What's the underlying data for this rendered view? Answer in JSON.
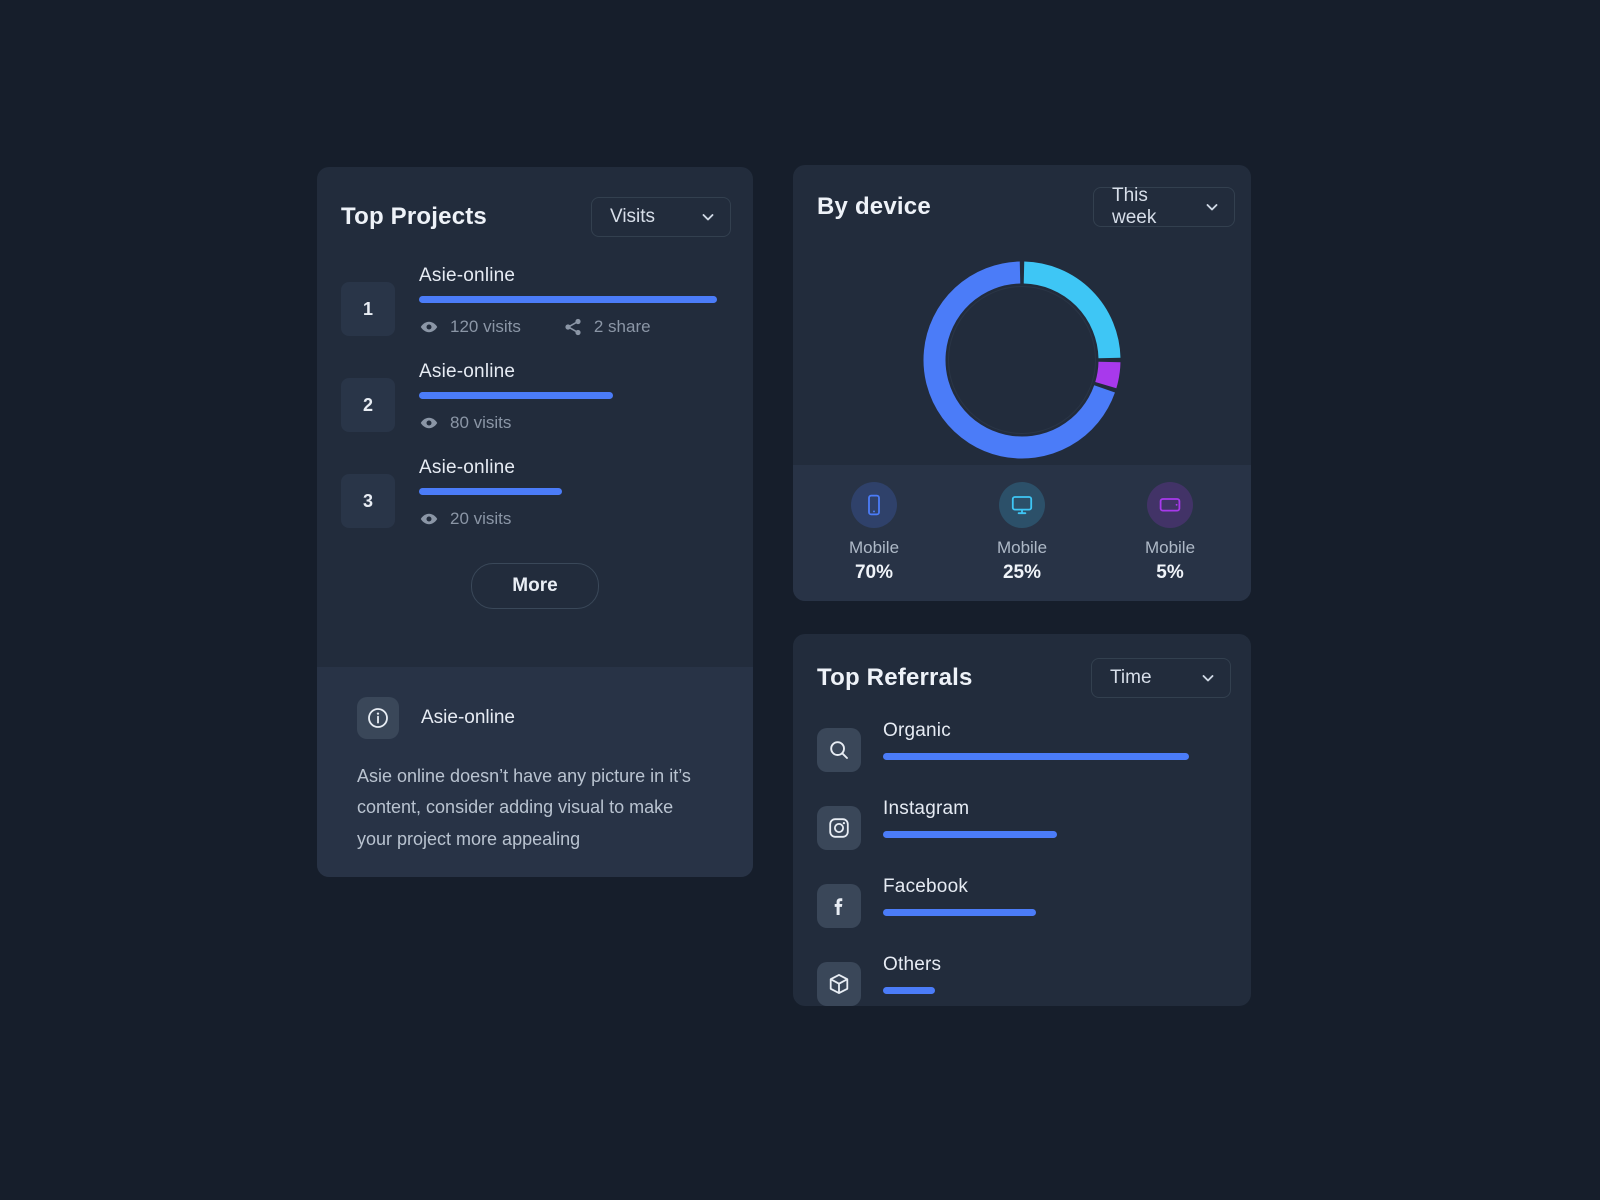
{
  "theme": {
    "page_bg": "#161e2b",
    "card_bg": "#222c3c",
    "panel_bg": "#283346",
    "accent_blue": "#4b7cf8",
    "accent_cyan": "#3ec6f5",
    "accent_purple": "#a839ec",
    "text_primary": "#e6ebf3",
    "text_muted": "#8b96a6"
  },
  "top_projects": {
    "title": "Top Projects",
    "filter": {
      "value": "Visits",
      "icon": "chevron-down-icon"
    },
    "items": [
      {
        "rank": "1",
        "name": "Asie-online",
        "bar_percent": 100,
        "visits_label": "120 visits",
        "visits_icon": "eye-icon",
        "shares_label": "2 share",
        "shares_icon": "share-icon"
      },
      {
        "rank": "2",
        "name": "Asie-online",
        "bar_percent": 65,
        "visits_label": "80 visits",
        "visits_icon": "eye-icon",
        "shares_label": "",
        "shares_icon": ""
      },
      {
        "rank": "3",
        "name": "Asie-online",
        "bar_percent": 48,
        "visits_label": "20 visits",
        "visits_icon": "eye-icon",
        "shares_label": "",
        "shares_icon": ""
      }
    ],
    "more_label": "More",
    "tip": {
      "icon": "info-icon",
      "title": "Asie-online",
      "text": "Asie online doesn’t have any picture in it’s content, consider adding visual to make your project more appealing"
    }
  },
  "by_device": {
    "title": "By device",
    "filter": {
      "value": "This week",
      "icon": "chevron-down-icon"
    },
    "devices": [
      {
        "label": "Mobile",
        "value": "70%",
        "icon": "mobile-phone-icon",
        "color": "#4b7cf8"
      },
      {
        "label": "Mobile",
        "value": "25%",
        "icon": "desktop-monitor-icon",
        "color": "#3ec6f5"
      },
      {
        "label": "Mobile",
        "value": "5%",
        "icon": "tablet-icon",
        "color": "#a839ec"
      }
    ]
  },
  "top_referrals": {
    "title": "Top Referrals",
    "filter": {
      "value": "Time",
      "icon": "chevron-down-icon"
    },
    "items": [
      {
        "name": "Organic",
        "icon": "search-icon",
        "bar_percent": 100
      },
      {
        "name": "Instagram",
        "icon": "instagram-icon",
        "bar_percent": 57
      },
      {
        "name": "Facebook",
        "icon": "facebook-icon",
        "bar_percent": 50
      },
      {
        "name": "Others",
        "icon": "box-icon",
        "bar_percent": 17
      }
    ]
  },
  "chart_data": {
    "type": "pie",
    "title": "By device",
    "subtitle": "This week",
    "categories": [
      "Mobile",
      "Mobile",
      "Mobile"
    ],
    "values": [
      70,
      25,
      5
    ],
    "colors": [
      "#4b7cf8",
      "#3ec6f5",
      "#a839ec"
    ],
    "units": "%",
    "legend_position": "bottom",
    "donut": true,
    "start_angle_deg": 0,
    "direction": "clockwise",
    "slice_order": [
      "25",
      "5",
      "70"
    ],
    "notes": "Donut: from 12 o'clock clockwise — cyan 25%, purple 5%, blue 70%"
  }
}
